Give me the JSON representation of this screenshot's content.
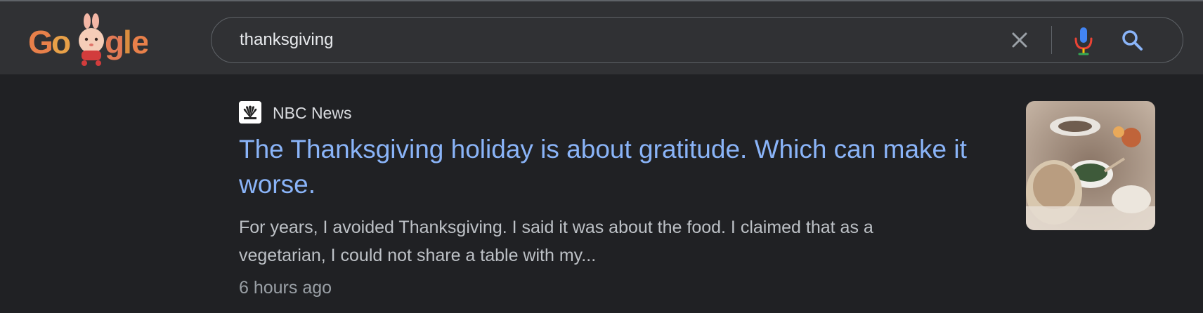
{
  "header": {
    "logo_text": "Google",
    "search": {
      "value": "thanksgiving",
      "clear_icon": "close-icon",
      "mic_icon": "mic-icon",
      "search_icon": "search-icon"
    }
  },
  "result": {
    "source": "NBC News",
    "favicon_icon": "nbc-peacock-icon",
    "title": "The Thanksgiving holiday is about gratitude. Which can make it worse.",
    "snippet": "For years, I avoided Thanksgiving. I said it was about the food. I claimed that as a vegetarian, I could not share a table with my...",
    "timestamp": "6 hours ago",
    "thumbnail": "thanksgiving-dinner-table-photo"
  },
  "colors": {
    "page_bg": "#202124",
    "header_bg": "#303134",
    "link": "#8ab4f8",
    "text": "#bdc1c6",
    "muted": "#9aa0a6"
  }
}
